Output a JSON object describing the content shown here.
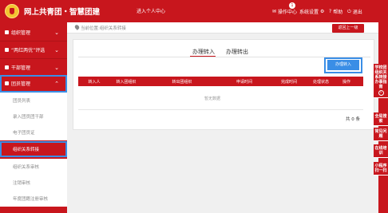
{
  "header": {
    "title": "网上共青团・智慧团建",
    "welcome": "进入个人中心",
    "nav": [
      {
        "icon": "mail-icon",
        "label": "操作中心",
        "badge": "1"
      },
      {
        "icon": "gear-icon",
        "label": "系统设置"
      },
      {
        "icon": "help-icon",
        "label": "帮助"
      },
      {
        "icon": "logout-icon",
        "label": "退出"
      }
    ]
  },
  "sidebar": {
    "items": [
      {
        "label": "组织管理",
        "chevron": "⌄"
      },
      {
        "label": "“两红两优”评选",
        "chevron": "⌄"
      },
      {
        "label": "干部管理",
        "chevron": "⌄"
      },
      {
        "label": "团员管理",
        "chevron": "⌃"
      }
    ],
    "subitems": [
      {
        "label": "团员列表"
      },
      {
        "label": "录入团员团干部"
      },
      {
        "label": "电子团员证"
      },
      {
        "label": "组织关系转接"
      },
      {
        "label": "组织关系审核"
      },
      {
        "label": "注销审核"
      },
      {
        "label": "年度团籍注册审核"
      }
    ]
  },
  "breadcrumb": {
    "text": "当前位置:组织关系转接"
  },
  "back_button": "返回上一级",
  "tabs": [
    {
      "label": "办理转入",
      "active": true
    },
    {
      "label": "办理转出",
      "active": false
    }
  ],
  "action_button": "办理转入",
  "table": {
    "columns": [
      "转入人",
      "转入团组织",
      "转出团组织",
      "申请时间",
      "完成时间",
      "处理状态",
      "操作"
    ],
    "empty_text": "暂无数据"
  },
  "pagination": {
    "total": "共 0 条"
  },
  "right_rail": [
    {
      "label": "学校团组织关系转接办事指南",
      "has_circle": true
    },
    {
      "label": "全局搜索"
    },
    {
      "label": "常见问题"
    },
    {
      "label": "在线培训"
    },
    {
      "label": "小程序扫一扫"
    }
  ],
  "colors": {
    "brand": "#c8161d",
    "accent": "#3a8ee6"
  }
}
